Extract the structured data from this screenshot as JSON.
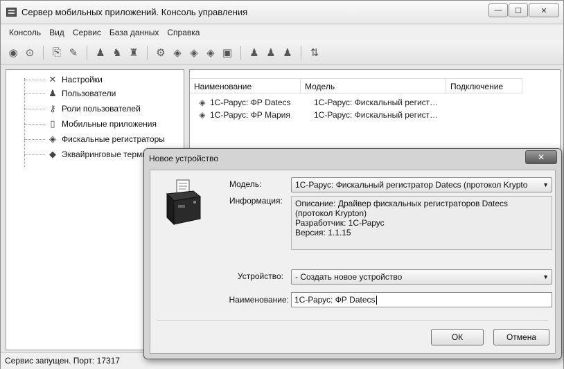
{
  "window": {
    "title": "Сервер мобильных приложений. Консоль управления",
    "controls": {
      "minimize": "—",
      "maximize": "☐",
      "close": "✕"
    }
  },
  "menu": [
    "Консоль",
    "Вид",
    "Сервис",
    "База данных",
    "Справка"
  ],
  "toolbar": {
    "groups": [
      [
        "record-icon",
        "stop-icon"
      ],
      [
        "connect-icon",
        "brush-icon"
      ],
      [
        "user-icon",
        "user-edit-icon",
        "user-delete-icon"
      ],
      [
        "settings-gear-icon",
        "device-add-icon",
        "device-edit-icon",
        "device-delete-icon",
        "terminal-icon"
      ],
      [
        "user-group-icon",
        "user-group-add-icon",
        "user-group-remove-icon"
      ],
      [
        "refresh-icon"
      ]
    ]
  },
  "tree": {
    "items": [
      {
        "label": "Настройки",
        "icon": "tools-icon"
      },
      {
        "label": "Пользователи",
        "icon": "user-icon"
      },
      {
        "label": "Роли пользователей",
        "icon": "key-icon"
      },
      {
        "label": "Мобильные приложения",
        "icon": "mobile-icon"
      },
      {
        "label": "Фискальные регистраторы",
        "icon": "fiscal-register-icon"
      },
      {
        "label": "Эквайринговые терминалы",
        "icon": "card-terminal-icon"
      }
    ]
  },
  "list": {
    "columns": [
      "Наименование",
      "Модель",
      "Подключение"
    ],
    "rows": [
      {
        "name": "1С-Рарус: ФР Datecs",
        "model": "1С-Рарус: Фискальный регист…",
        "connection": ""
      },
      {
        "name": "1С-Рарус: ФР Мария",
        "model": "1С-Рарус: Фискальный регист…",
        "connection": ""
      }
    ]
  },
  "status": {
    "text": "Сервис запущен. Порт: 17317"
  },
  "dialog": {
    "title": "Новое устройство",
    "close": "✕",
    "model_label": "Модель:",
    "model_value": "1С-Рарус: Фискальный регистратор Datecs (протокол Krypto",
    "info_label": "Информация:",
    "info_lines": [
      "Описание: Драйвер фискальных регистраторов Datecs",
      "(протокол Krypton)",
      "Разработчик: 1С-Рарус",
      "Версия: 1.1.15"
    ],
    "device_label": "Устройство:",
    "device_value": "- Создать новое устройство",
    "name_label": "Наименование:",
    "name_value": "1С-Рарус: ФР Datecs",
    "ok_label": "ОК",
    "cancel_label": "Отмена"
  }
}
